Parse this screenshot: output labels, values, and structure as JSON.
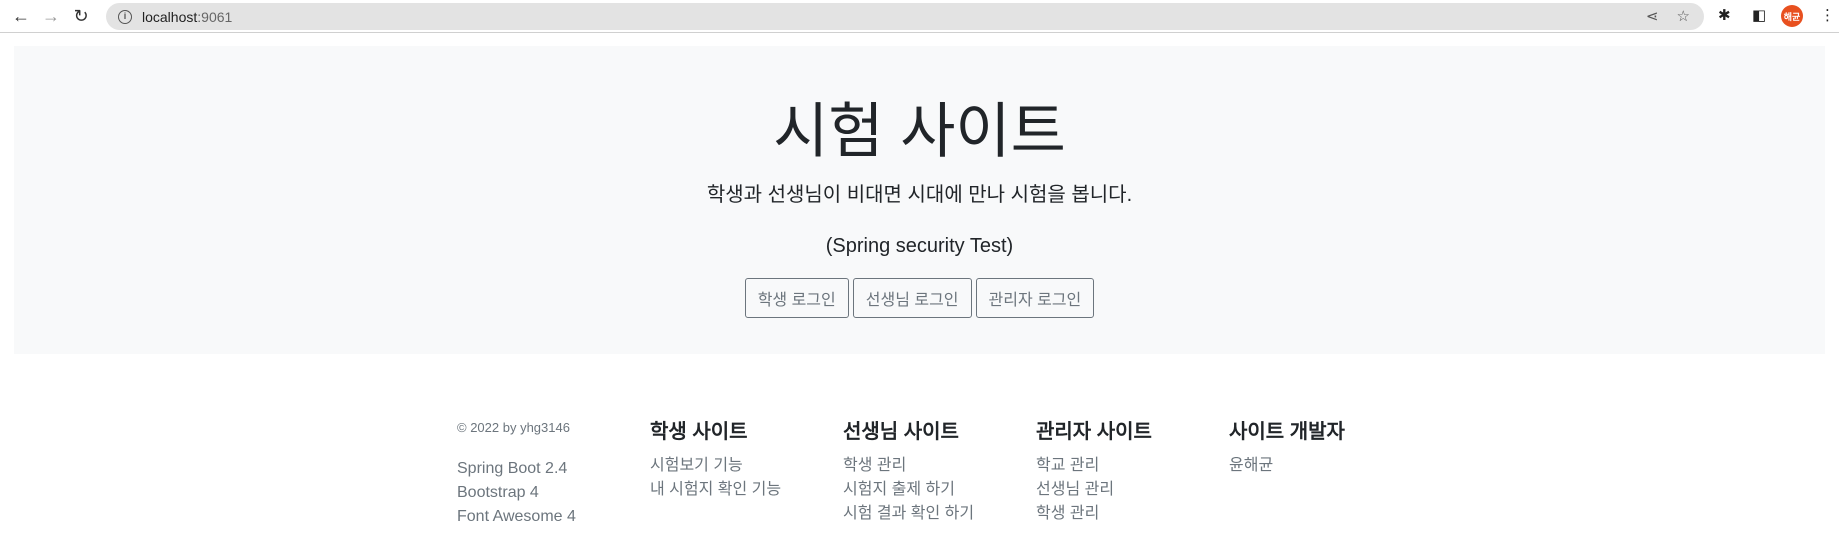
{
  "browser": {
    "url_host": "localhost",
    "url_port": ":9061",
    "profile_initials": "해균"
  },
  "hero": {
    "title": "시험 사이트",
    "lead": "학생과 선생님이 비대면 시대에 만나 시험을 봅니다.",
    "sub": "(Spring security Test)",
    "buttons": [
      "학생 로그인",
      "선생님 로그인",
      "관리자 로그인"
    ]
  },
  "footer": {
    "copyright": "© 2022 by yhg3146",
    "tech": [
      "Spring Boot 2.4",
      "Bootstrap 4",
      "Font Awesome 4"
    ],
    "columns": [
      {
        "title": "학생 사이트",
        "links": [
          "시험보기 기능",
          "내 시험지 확인 기능"
        ]
      },
      {
        "title": "선생님 사이트",
        "links": [
          "학생 관리",
          "시험지 출제 하기",
          "시험 결과 확인 하기"
        ]
      },
      {
        "title": "관리자 사이트",
        "links": [
          "학교 관리",
          "선생님 관리",
          "학생 관리"
        ]
      },
      {
        "title": "사이트 개발자",
        "links": [
          "윤해균"
        ]
      }
    ]
  }
}
